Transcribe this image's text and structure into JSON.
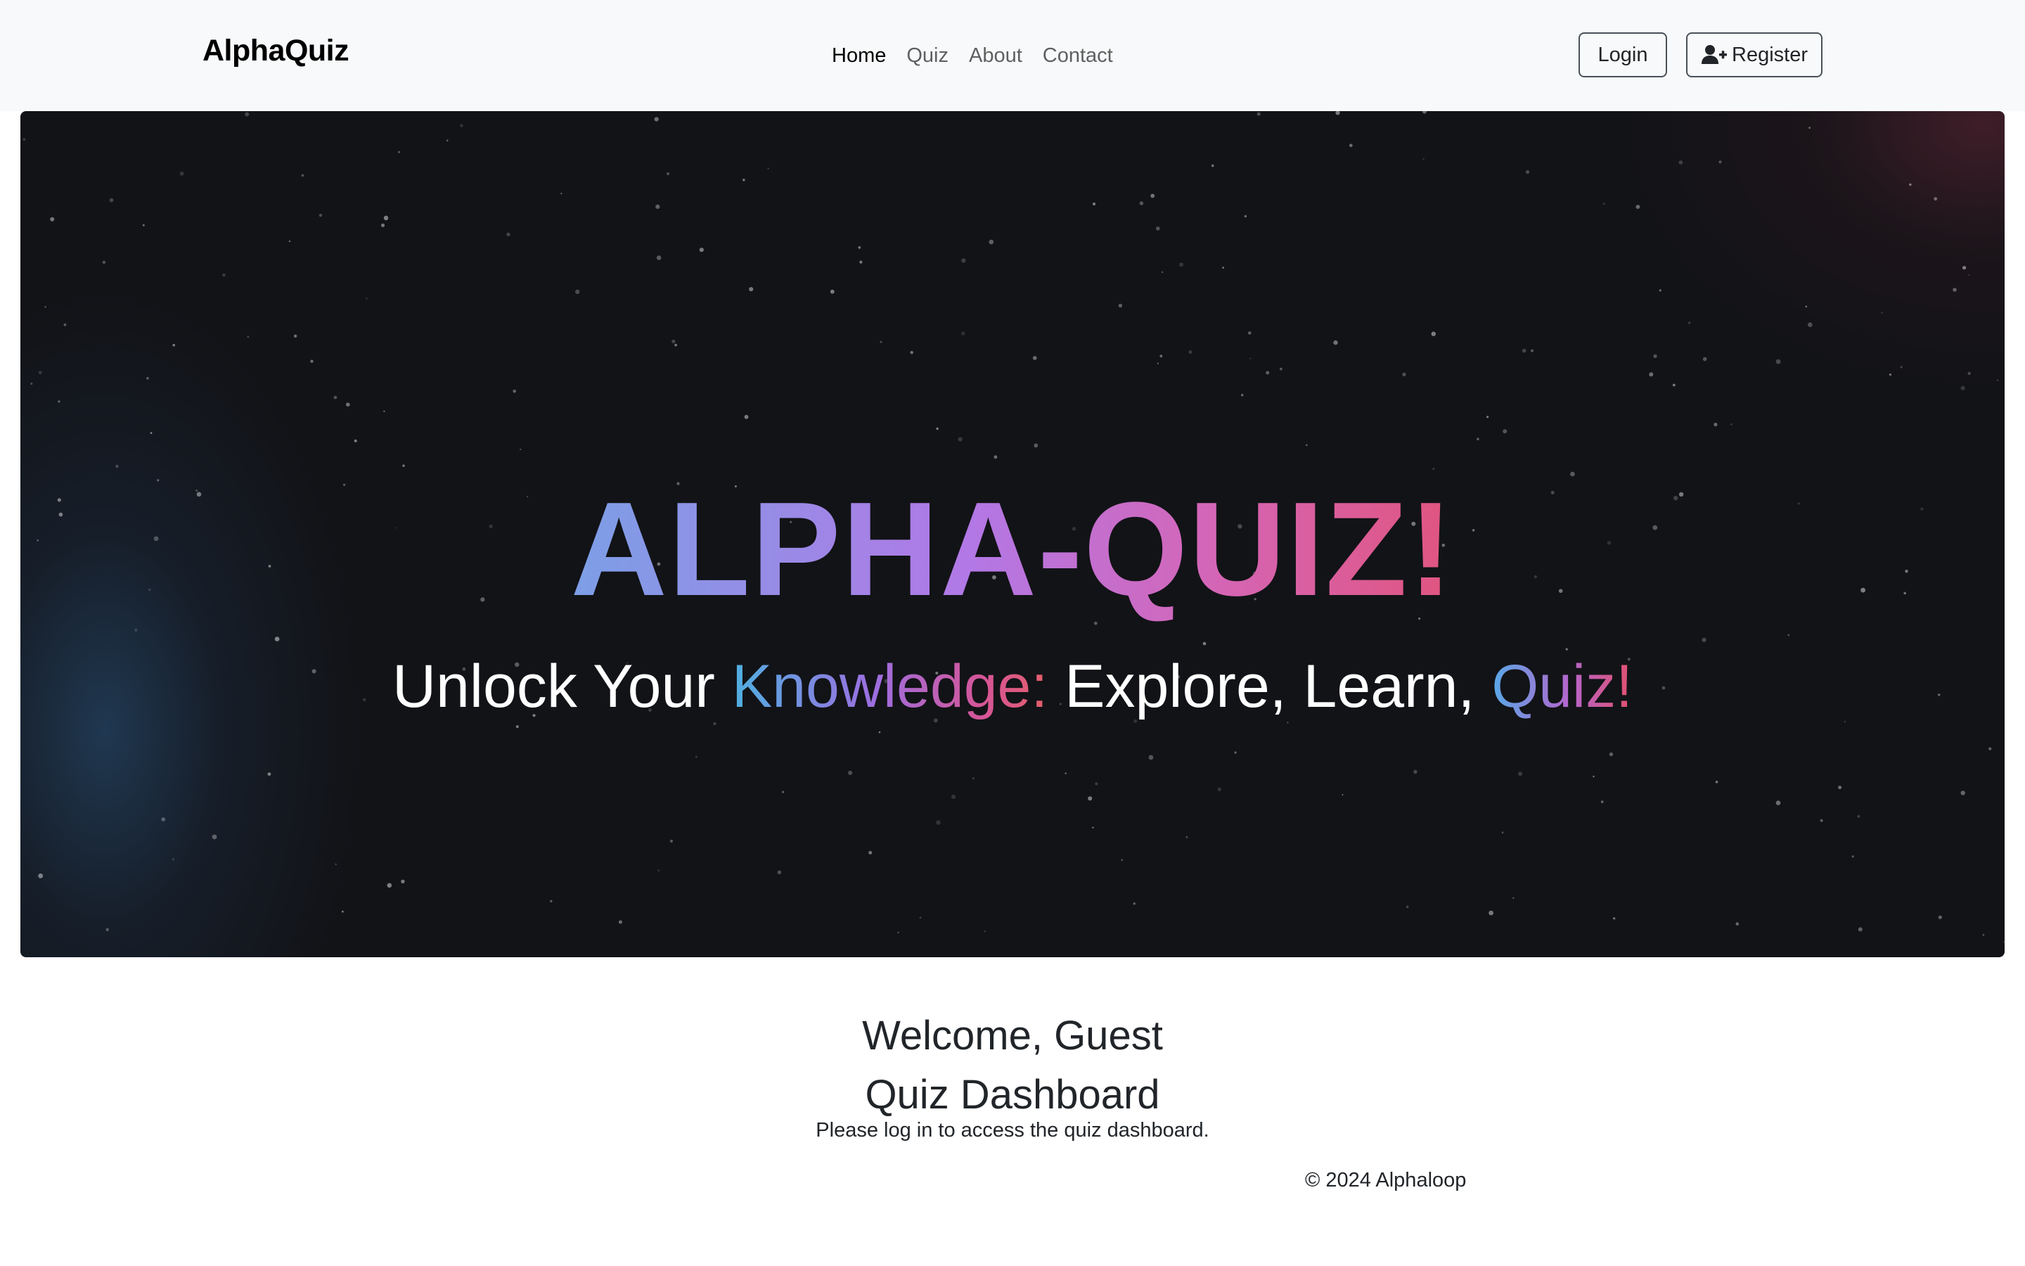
{
  "navbar": {
    "brand": "AlphaQuiz",
    "links": [
      {
        "label": "Home",
        "active": true
      },
      {
        "label": "Quiz",
        "active": false
      },
      {
        "label": "About",
        "active": false
      },
      {
        "label": "Contact",
        "active": false
      }
    ],
    "login_label": "Login",
    "register_label": "Register",
    "register_icon": "user-plus-icon"
  },
  "hero": {
    "title": "ALPHA-QUIZ!",
    "subtitle_part1": "Unlock Your ",
    "subtitle_highlight1": "Knowledge:",
    "subtitle_part2": " Explore, Learn, ",
    "subtitle_highlight2": "Quiz!",
    "background_color": "#121317",
    "title_gradient": [
      "#7c9fe6",
      "#b278e6",
      "#d466b8",
      "#e0557f"
    ]
  },
  "main": {
    "welcome": "Welcome, Guest",
    "dashboard_title": "Quiz Dashboard",
    "login_message": "Please log in to access the quiz dashboard."
  },
  "footer": {
    "copyright": "© 2024 Alphaloop"
  }
}
